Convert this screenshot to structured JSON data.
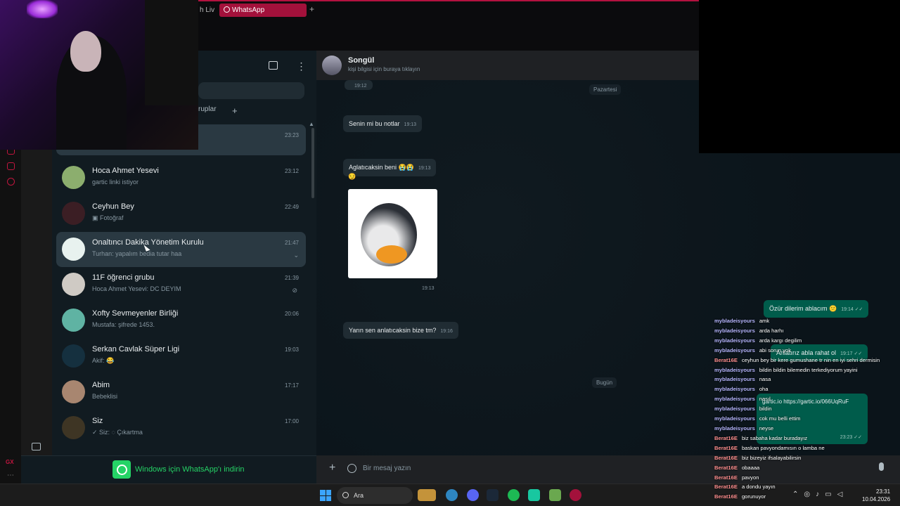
{
  "browser": {
    "tab_partial": "h Liv",
    "tab_active": "WhatsApp",
    "new_tab": "+"
  },
  "left_panel": {
    "filter_label": "ruplar",
    "filter_add": "+",
    "top_chat_time": "23:23",
    "chats": [
      {
        "name": "Hoca Ahmet Yesevi",
        "message": "gartic linki istiyor",
        "time": "23:12"
      },
      {
        "name": "Ceyhun Bey",
        "message": "▣ Fotoğraf",
        "time": "22:49"
      },
      {
        "name": "Onaltıncı Dakika Yönetim Kurulu",
        "message": "Turhan: yapalım bedia tutar haa",
        "time": "21:47",
        "chevron": "⌄"
      },
      {
        "name": "11F öğrenci grubu",
        "message": "Hoca Ahmet Yesevi: DC DEYIM",
        "time": "21:39",
        "muted": "⊘"
      },
      {
        "name": "Xofty Sevmeyenler Birliği",
        "message": "Mustafa: şifrede 1453.",
        "time": "20:06"
      },
      {
        "name": "Serkan Cavlak Süper Ligi",
        "message": "Akif: 😂",
        "time": "19:03"
      },
      {
        "name": "Abim",
        "message": "Bebeklisi",
        "time": "17:17"
      },
      {
        "name": "Siz",
        "message": "✓ Siz: ◌ Çıkartma",
        "time": "17:00"
      }
    ],
    "download_text": "Windows için WhatsApp'ı indirin"
  },
  "chat_panel": {
    "contact_name": "Songül",
    "contact_sub": "kişi bilgisi için buraya tıklayın",
    "day_monday": "Pazartesi",
    "day_today": "Bugün",
    "messages": [
      {
        "text": "Senin mi bu notlar",
        "time": "19:13"
      },
      {
        "text": "Aglatıcaksin beni 😭😭",
        "time": "19:13"
      },
      {
        "text": "😏",
        "time": ""
      },
      {
        "text": "Yarın sen anlatıcaksin bize tm?",
        "time": "19:16"
      }
    ],
    "top_partial_time": "19:12",
    "sticker_time": "19:13",
    "outgoing": [
      {
        "text": "Özür dilerim ablacım 😕",
        "time": "19:14 ✓✓"
      },
      {
        "text": "Anlatırız abla rahat ol",
        "time": "19:17 ✓✓"
      },
      {
        "text": "gartic.io https://gartic.io/066UqRuF",
        "time": "23:23 ✓✓"
      }
    ],
    "input_placeholder": "Bir mesaj yazın"
  },
  "twitch_chat": [
    {
      "user": "mybladeisyours",
      "text": "amk",
      "type": "u1"
    },
    {
      "user": "mybladeisyours",
      "text": "arda harhı",
      "type": "u1"
    },
    {
      "user": "mybladeisyours",
      "text": "arda kargı degilim",
      "type": "u1"
    },
    {
      "user": "mybladeisyours",
      "text": "abi sorun yok",
      "type": "u1"
    },
    {
      "user": "Berat16E",
      "text": "ceyhun bey bir kere gumushane tr nin en iyi sehri dermisin",
      "type": "u2"
    },
    {
      "user": "mybladeisyours",
      "text": "bildin bildin bilemedin terkediyorum yayini",
      "type": "u1"
    },
    {
      "user": "mybladeisyours",
      "text": "nasa",
      "type": "u1"
    },
    {
      "user": "mybladeisyours",
      "text": "oha",
      "type": "u1"
    },
    {
      "user": "mybladeisyours",
      "text": "nasıl",
      "type": "u1"
    },
    {
      "user": "mybladeisyours",
      "text": "bildin",
      "type": "u1"
    },
    {
      "user": "mybladeisyours",
      "text": "cok mu belli ettim",
      "type": "u1"
    },
    {
      "user": "mybladeisyours",
      "text": "neyse",
      "type": "u1"
    },
    {
      "user": "Berat16E",
      "text": "biz sabaha kadar buradayız",
      "type": "u2"
    },
    {
      "user": "Berat16E",
      "text": "baskan pavyondamısın o lamba ne",
      "type": "u2"
    },
    {
      "user": "Berat16E",
      "text": "biz bizeyiz ifsalayabilirsin",
      "type": "u2"
    },
    {
      "user": "Berat16E",
      "text": "obaaaa",
      "type": "u2"
    },
    {
      "user": "Berat16E",
      "text": "pavyon",
      "type": "u2"
    },
    {
      "user": "Berat16E",
      "text": "a dondu yayın",
      "type": "u2"
    },
    {
      "user": "Berat16E",
      "text": "gorunuyor",
      "type": "u2"
    }
  ],
  "taskbar": {
    "search": "Ara",
    "time": "23:31",
    "date": "10.04.2026"
  },
  "colors": {
    "accent": "#25d366",
    "opera_red": "#c2163f",
    "panel": "#111b21",
    "outgoing_bubble": "#005c4b"
  }
}
